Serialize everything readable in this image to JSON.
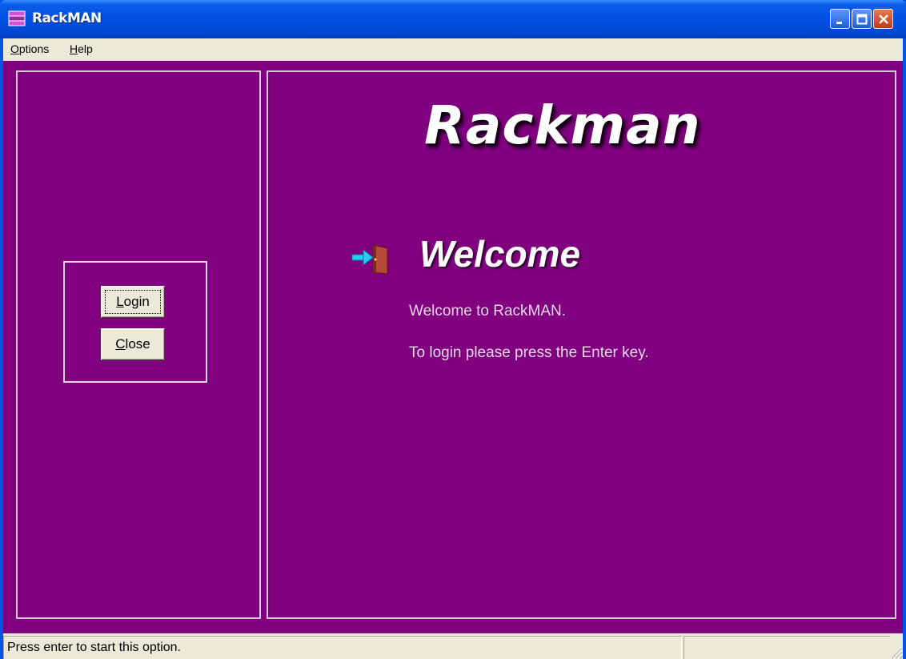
{
  "window": {
    "title": "RackMAN"
  },
  "menu": {
    "items": [
      {
        "label": "Options",
        "accel": "O",
        "rest": "ptions"
      },
      {
        "label": "Help",
        "accel": "H",
        "rest": "elp"
      }
    ]
  },
  "left_panel": {
    "login_button": {
      "label": "Login",
      "accel": "L",
      "rest": "ogin"
    },
    "close_button": {
      "label": "Close",
      "accel": "C",
      "rest": "lose"
    }
  },
  "main": {
    "brand": "Rackman",
    "heading": "Welcome",
    "message_line1": "Welcome to RackMAN.",
    "message_line2": "To login please press the Enter key."
  },
  "status": {
    "text": "Press enter to start this option."
  },
  "colors": {
    "background": "#800080",
    "titlebar": "#0054e3",
    "chrome": "#ece9d8"
  },
  "icons": [
    "app-icon",
    "minimize-icon",
    "maximize-icon",
    "close-icon",
    "login-door-icon",
    "resize-grip-icon"
  ]
}
